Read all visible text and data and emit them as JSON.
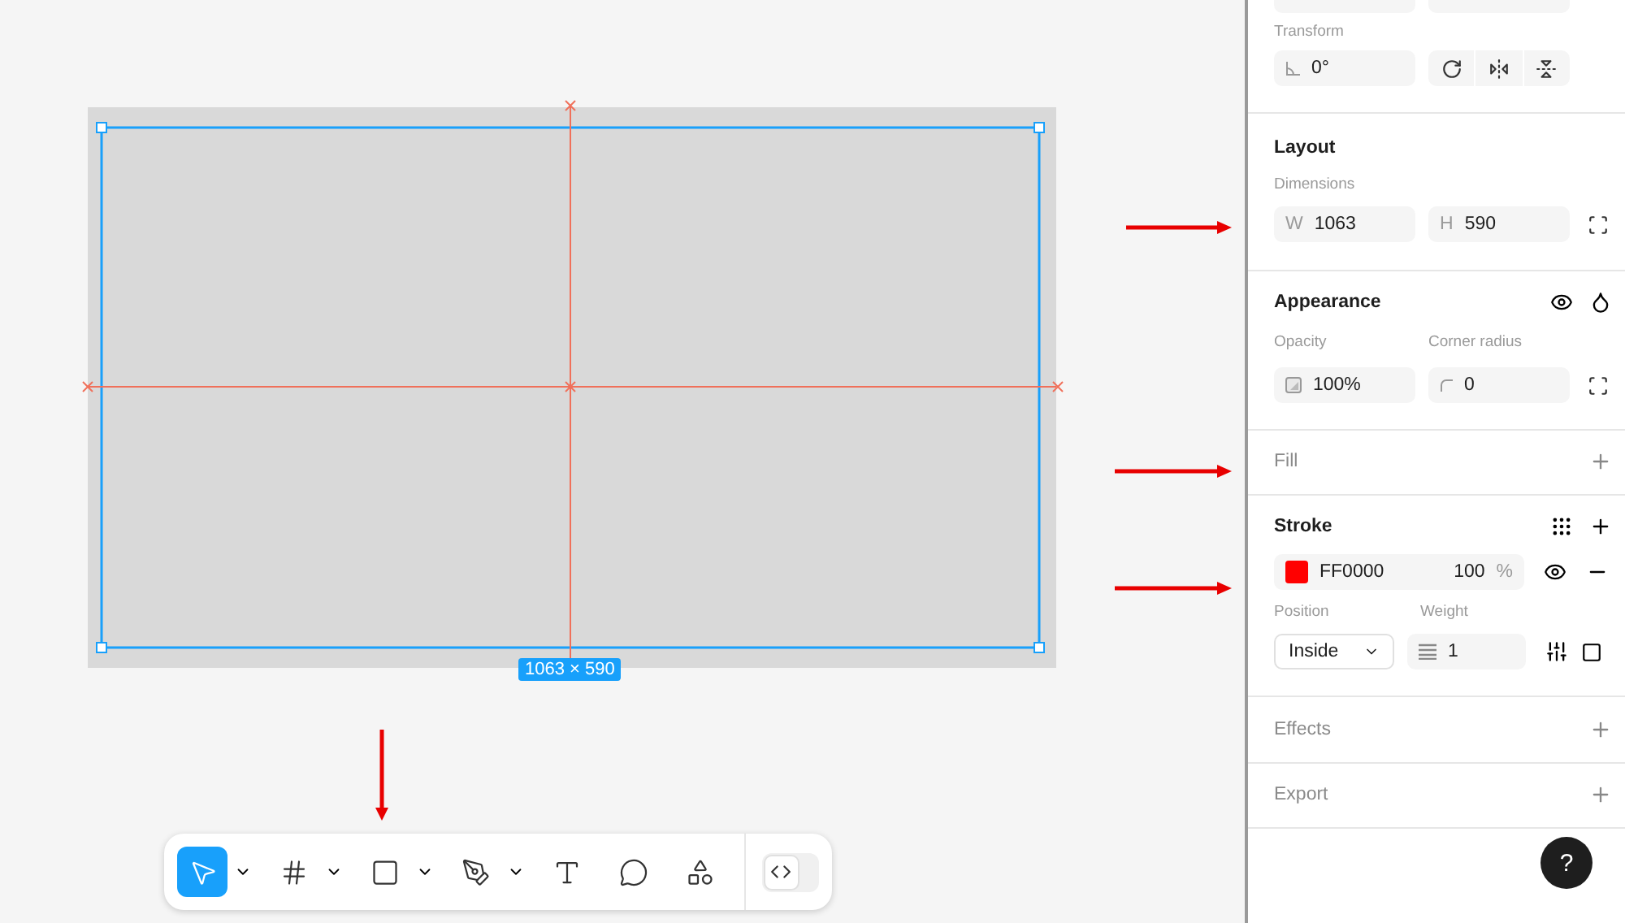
{
  "canvas": {
    "frame_size": "1063 × 590"
  },
  "toolbar": {
    "tools": [
      {
        "kind": "move",
        "selected": true,
        "dropdown": true
      },
      {
        "kind": "frame",
        "selected": false,
        "dropdown": true
      },
      {
        "kind": "rectangle",
        "selected": false,
        "dropdown": true
      },
      {
        "kind": "pen",
        "selected": false,
        "dropdown": true
      },
      {
        "kind": "text",
        "selected": false,
        "dropdown": false
      },
      {
        "kind": "comment",
        "selected": false,
        "dropdown": false
      },
      {
        "kind": "actions",
        "selected": false,
        "dropdown": false
      }
    ],
    "dev_mode": {
      "on": false
    }
  },
  "panel": {
    "transform": {
      "label": "Transform",
      "rotation": "0°"
    },
    "layout": {
      "title": "Layout",
      "dimensions_label": "Dimensions",
      "width": {
        "prefix": "W",
        "value": "1063"
      },
      "height": {
        "prefix": "H",
        "value": "590"
      }
    },
    "appearance": {
      "title": "Appearance",
      "opacity_label": "Opacity",
      "opacity": "100%",
      "corner_radius_label": "Corner radius",
      "corner_radius": "0"
    },
    "fill": {
      "title": "Fill",
      "empty": true
    },
    "stroke": {
      "title": "Stroke",
      "empty": false,
      "color": "#ff0000",
      "hex": "FF0000",
      "opacity": "100",
      "unit": "%",
      "position_label": "Position",
      "position": "Inside",
      "weight_label": "Weight",
      "weight": "1"
    },
    "effects": {
      "title": "Effects",
      "empty": true
    },
    "export": {
      "title": "Export",
      "empty": true
    },
    "help": "?"
  }
}
